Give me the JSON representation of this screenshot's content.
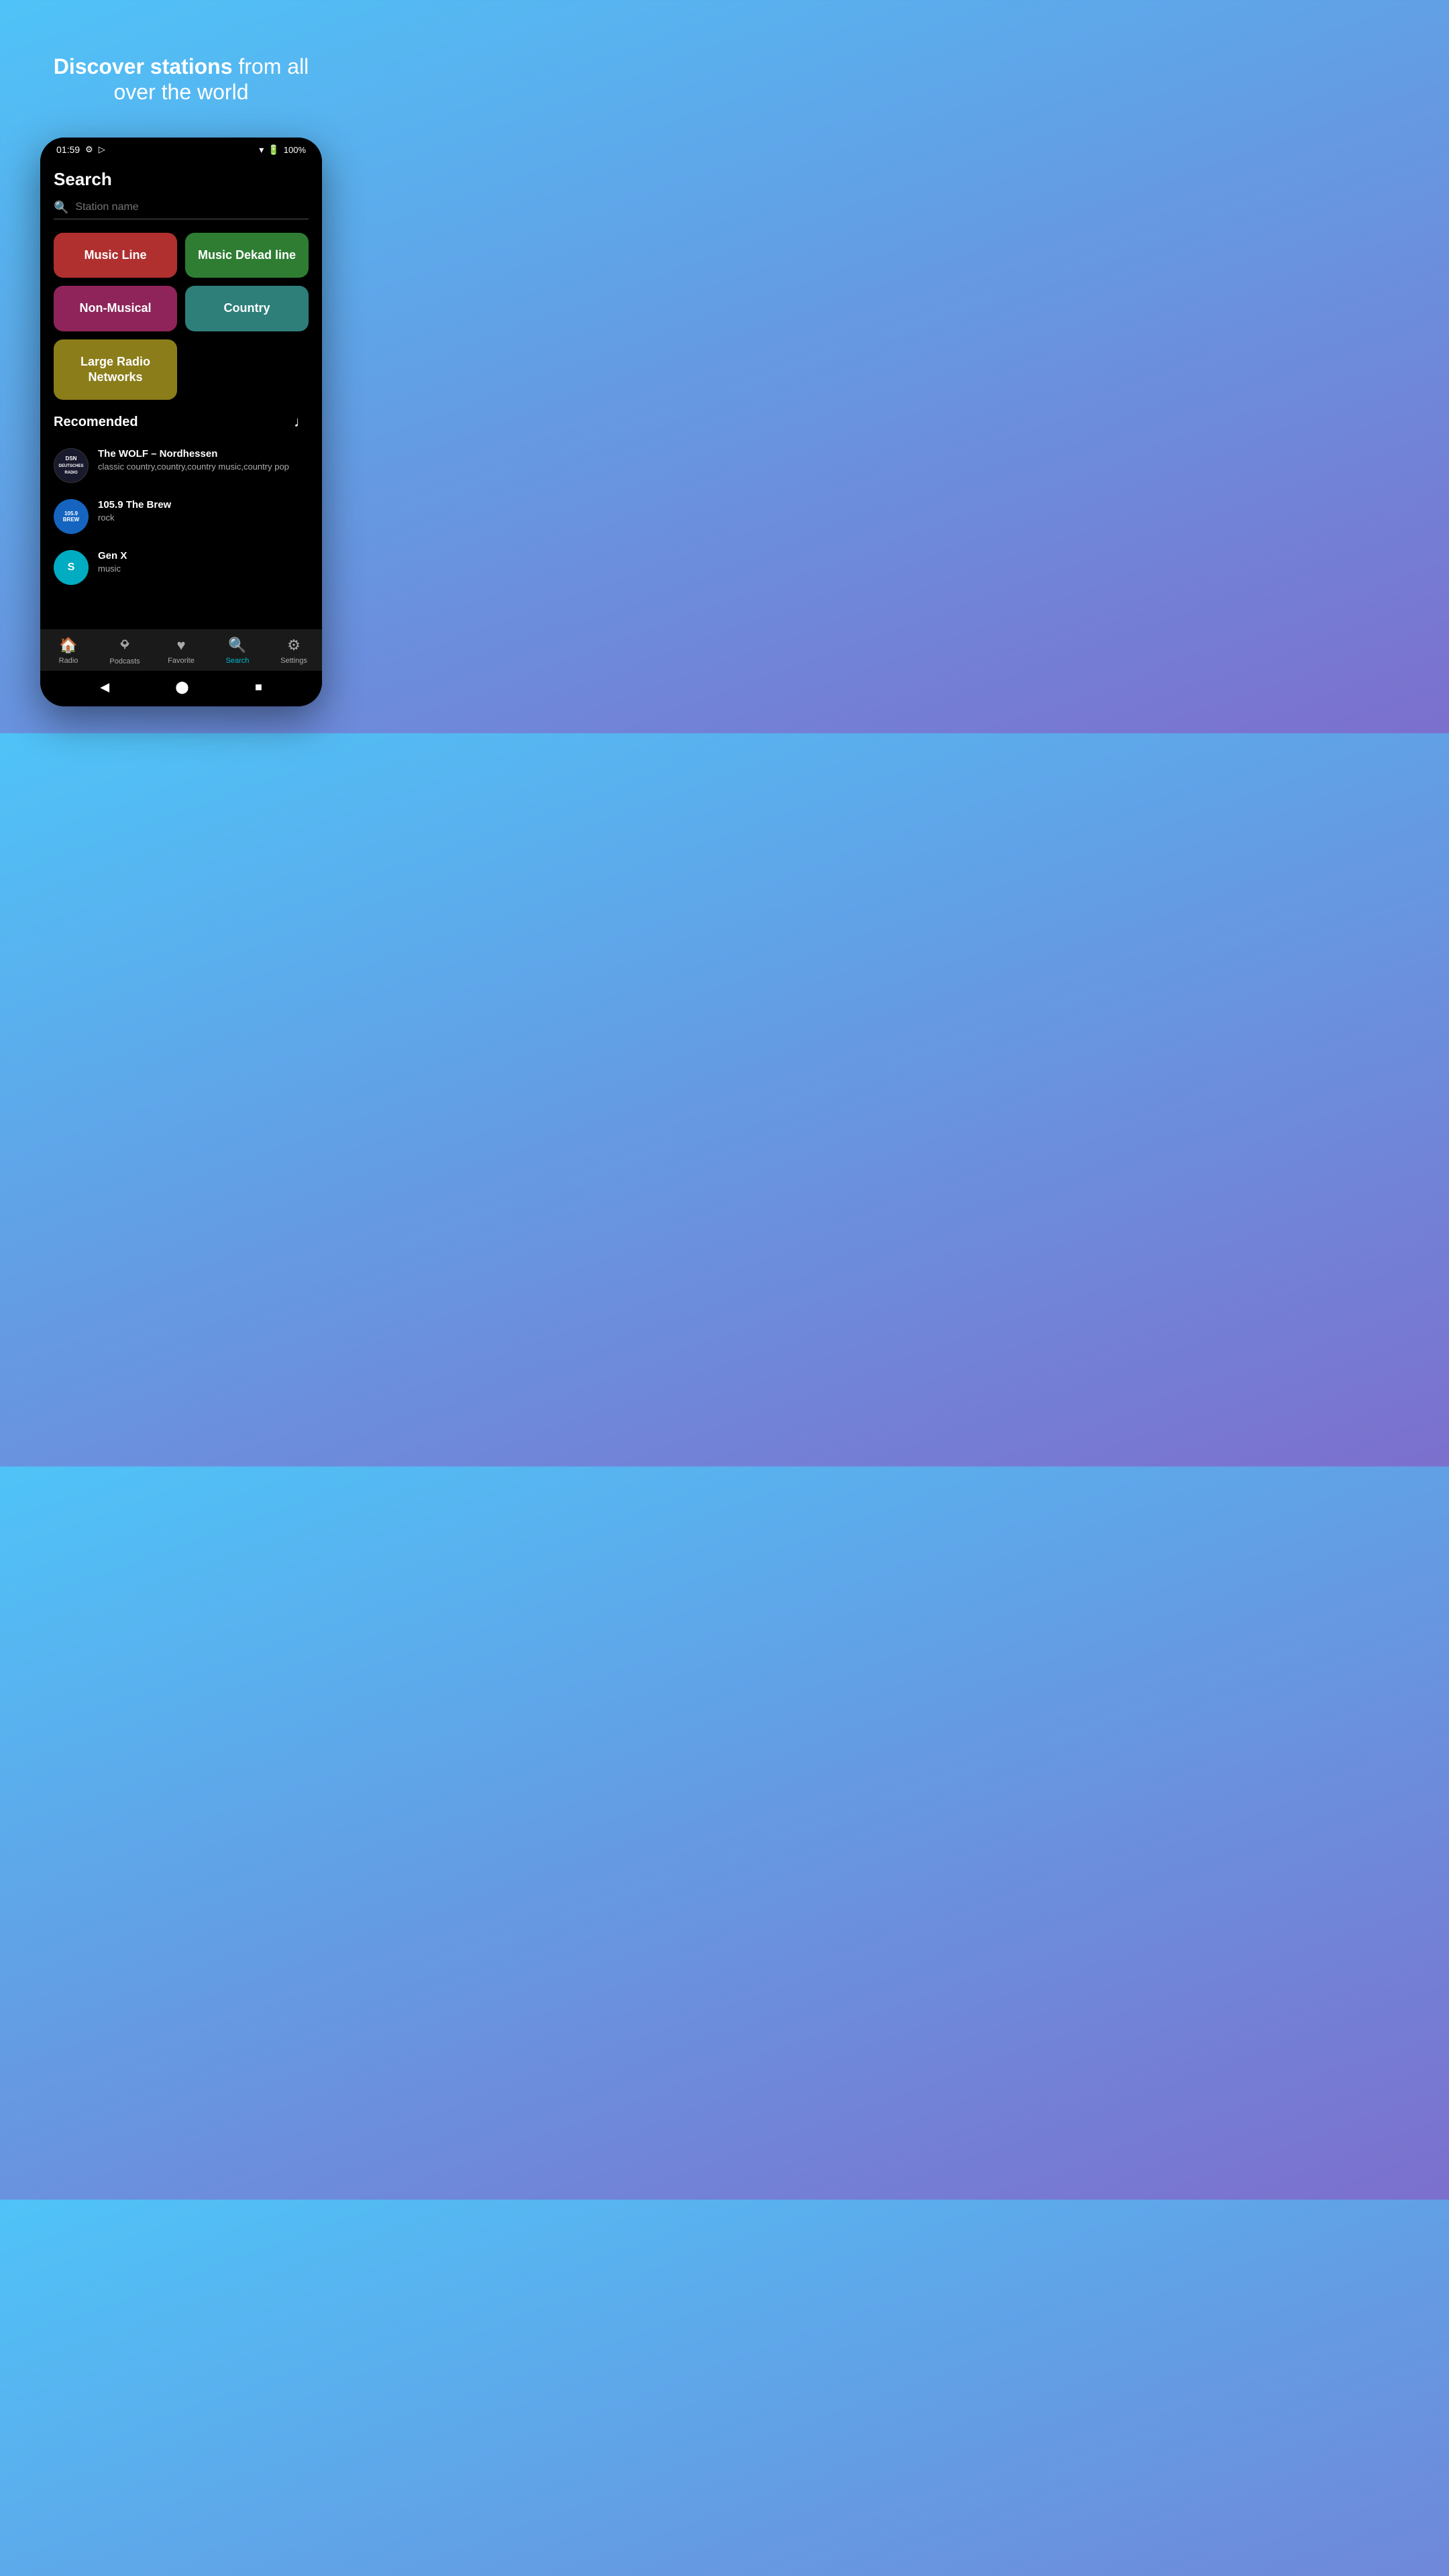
{
  "hero": {
    "title_bold": "Discover stations",
    "title_rest": " from all\nover the world"
  },
  "status_bar": {
    "time": "01:59",
    "battery": "100%"
  },
  "page": {
    "title": "Search",
    "search_placeholder": "Station name"
  },
  "categories": [
    {
      "id": "music-line",
      "label": "Music Line",
      "class": "cat-music-line"
    },
    {
      "id": "music-dekad-line",
      "label": "Music Dekad line",
      "class": "cat-music-dekad"
    },
    {
      "id": "non-musical",
      "label": "Non-Musical",
      "class": "cat-non-musical"
    },
    {
      "id": "country",
      "label": "Country",
      "class": "cat-country"
    },
    {
      "id": "large-radio",
      "label": "Large Radio Networks",
      "class": "cat-large-radio"
    }
  ],
  "recommended": {
    "section_title": "Recomended",
    "stations": [
      {
        "id": "wolf-nordhessen",
        "name": "The WOLF – Nordhessen",
        "tags": "classic country,country,country music,country pop",
        "logo_text": "DSN",
        "logo_class": "logo-dsn"
      },
      {
        "id": "brew",
        "name": "105.9 The Brew",
        "tags": "rock",
        "logo_text": "105.9\nBREW",
        "logo_class": "logo-brew"
      },
      {
        "id": "genx",
        "name": "Gen X",
        "tags": "music",
        "logo_text": "S",
        "logo_class": "logo-genx"
      }
    ]
  },
  "bottom_nav": [
    {
      "id": "radio",
      "label": "Radio",
      "icon": "🏠",
      "active": false
    },
    {
      "id": "podcasts",
      "label": "Podcasts",
      "icon": "🎙",
      "active": false
    },
    {
      "id": "favorite",
      "label": "Favorite",
      "icon": "♥",
      "active": false
    },
    {
      "id": "search",
      "label": "Search",
      "icon": "🔍",
      "active": true
    },
    {
      "id": "settings",
      "label": "Settings",
      "icon": "⚙",
      "active": false
    }
  ],
  "android_nav": {
    "back": "◀",
    "home": "⬤",
    "recents": "■"
  }
}
